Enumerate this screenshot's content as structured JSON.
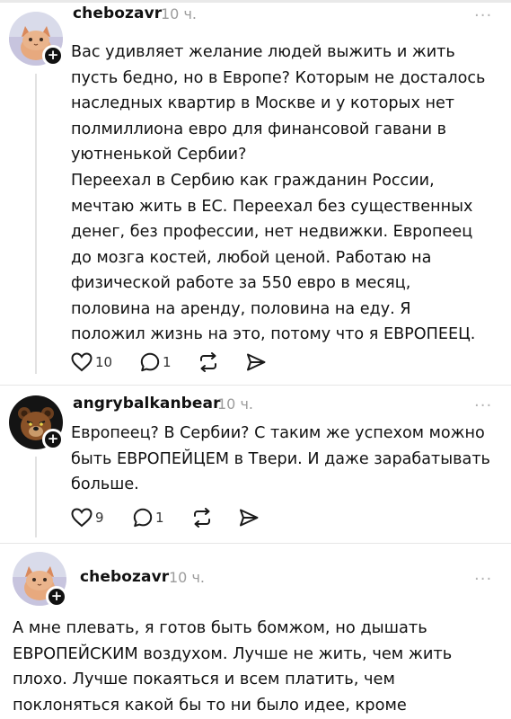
{
  "posts": [
    {
      "username": "chebozavr",
      "time": "10 ч.",
      "paragraphs": [
        "Вас удивляет желание людей выжить и жить пусть бедно, но в Европе? Которым не досталось наследных квартир в Москве и у которых нет полмиллиона евро для финансовой гавани в уютненькой Сербии?",
        "Переехал в Сербию как гражданин России, мечтаю жить в ЕС. Переехал без существенных денег, без профессии, нет недвижки. Европеец до мозга костей, любой ценой. Работаю на физической работе за 550 евро в месяц, половина на аренду, половина на еду. Я положил жизнь на это, потому что я ЕВРОПЕЕЦ."
      ],
      "likes": "10",
      "replies": "1",
      "avatar_icon": "cat-avatar"
    },
    {
      "username": "angrybalkanbear",
      "time": "10 ч.",
      "paragraphs": [
        "Европеец? В Сербии? С таким же успехом можно быть ЕВРОПЕЙЦЕМ в Твери. И даже зарабатывать больше."
      ],
      "likes": "9",
      "replies": "1",
      "avatar_icon": "bear-avatar"
    },
    {
      "username": "chebozavr",
      "time": "10 ч.",
      "paragraphs": [
        "А мне плевать, я готов быть бомжом, но дышать ЕВРОПЕЙСКИМ воздухом. Лучше не жить, чем жить плохо. Лучше покаяться и всем платить, чем поклоняться какой бы то ни было идее, кроме благополучия человека"
      ],
      "avatar_icon": "cat-avatar"
    }
  ],
  "more_glyph": "···",
  "plus_glyph": "+",
  "colors": {
    "text": "#111111",
    "muted": "#9c9c9c",
    "icon": "#1a1a1a",
    "plus_badge": "#111111"
  }
}
